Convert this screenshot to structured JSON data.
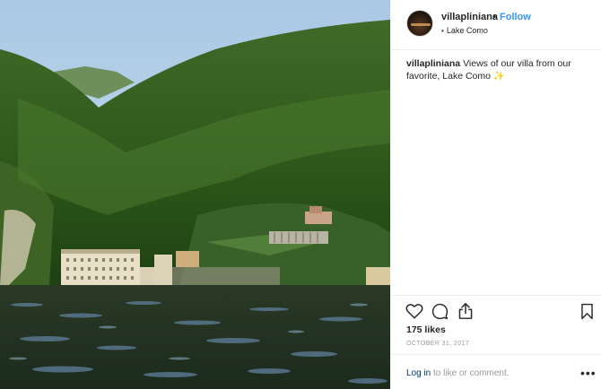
{
  "post": {
    "image_alt": "Villa Pliniana on the shore of Lake Como beneath forested hills",
    "username": "villapliniana",
    "separator": "•",
    "follow_label": "Follow",
    "location_bullet": "•",
    "location": "Lake Como",
    "caption_user": "villapliniana",
    "caption_text": "Views of our villa from our favorite, Lake Como ✨",
    "likes": "175 likes",
    "date": "OCTOBER 31, 2017",
    "login_link": "Log in",
    "login_rest": " to like or comment.",
    "more_label": "•••"
  },
  "icons": {
    "like": "heart-icon",
    "comment": "comment-icon",
    "share": "share-icon",
    "save": "bookmark-icon"
  },
  "colors": {
    "link_blue": "#3897f0",
    "text": "#262626",
    "muted": "#999999",
    "login_link": "#003569"
  }
}
